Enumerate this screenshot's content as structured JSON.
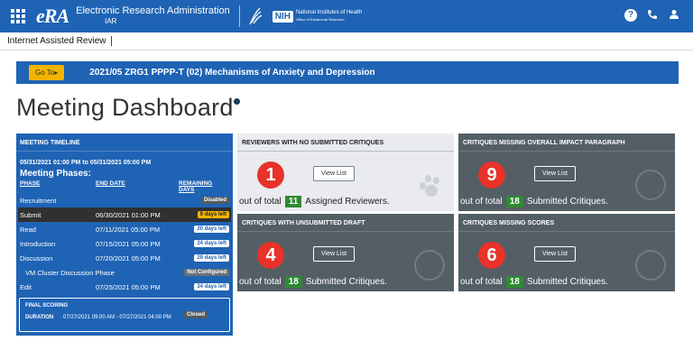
{
  "header": {
    "logo": "eRA",
    "app_title": "Electronic Research Administration",
    "app_sub": "IAR",
    "nih_badge": "NIH",
    "nih_name": "National Institutes of Health",
    "nih_sub": "Office of Extramural Research",
    "icons": [
      "help-icon",
      "phone-icon",
      "user-icon"
    ]
  },
  "subnav": {
    "label": "Internet Assisted Review"
  },
  "meeting_bar": {
    "goto_label": "Go To▸",
    "title": "2021/05 ZRG1 PPPP-T (02)  Mechanisms of Anxiety and Depression"
  },
  "page_title": "Meeting Dashboard",
  "timeline": {
    "header": "MEETING TIMELINE",
    "date_range": "05/31/2021 01:00 PM to 05/31/2021 05:00 PM",
    "phases_title": "Meeting Phases:",
    "columns": [
      "PHASE",
      "END DATE",
      "REMAINING DAYS"
    ],
    "rows": [
      {
        "phase": "Recruitment",
        "end": "",
        "badge": "Disabled",
        "kind": "disabled"
      },
      {
        "phase": "Submit",
        "end": "06/30/2021 01:00 PM",
        "badge": "9 days left",
        "kind": "warn"
      },
      {
        "phase": "Read",
        "end": "07/11/2021 05:00 PM",
        "badge": "20 days left",
        "kind": "normal"
      },
      {
        "phase": "Introduction",
        "end": "07/15/2021 05:00 PM",
        "badge": "24 days left",
        "kind": "normal"
      },
      {
        "phase": "Discussion",
        "end": "07/20/2021 05:00 PM",
        "badge": "29 days left",
        "kind": "normal"
      },
      {
        "phase": "VM Cluster Discussion Phase",
        "end": "",
        "badge": "Not Configured",
        "kind": "notconf"
      },
      {
        "phase": "Edit",
        "end": "07/25/2021 05:00 PM",
        "badge": "34 days left",
        "kind": "normal"
      }
    ],
    "final_scoring": {
      "label": "FINAL SCORING",
      "badge": "Closed",
      "duration_label": "DURATION",
      "duration": "07/27/2021 09:00 AM - 07/27/2021 04:00 PM"
    }
  },
  "cards": [
    {
      "title": "REVIEWERS WITH NO SUBMITTED CRITIQUES",
      "number": "1",
      "button": "View List",
      "prefix": "out of total",
      "count": "11",
      "suffix": "Assigned Reviewers."
    },
    {
      "title": "CRITIQUES MISSING OVERALL IMPACT PARAGRAPH",
      "number": "9",
      "button": "View List",
      "prefix": "out of total",
      "count": "18",
      "suffix": "Submitted Critiques."
    },
    {
      "title": "CRITIQUES WITH UNSUBMITTED DRAFT",
      "number": "4",
      "button": "View List",
      "prefix": "out of total",
      "count": "18",
      "suffix": "Submitted Critiques."
    },
    {
      "title": "CRITIQUES MISSING SCORES",
      "number": "6",
      "button": "View List",
      "prefix": "out of total",
      "count": "18",
      "suffix": "Submitted Critiques."
    }
  ]
}
